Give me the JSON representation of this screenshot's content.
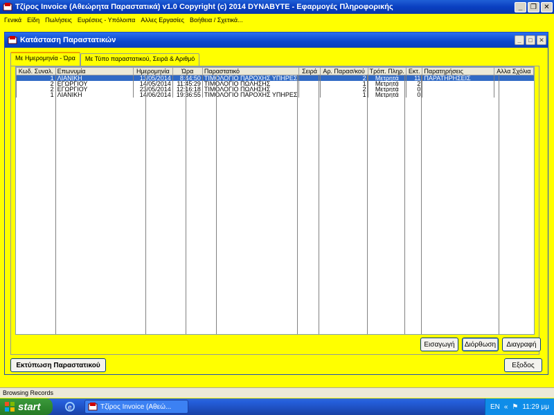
{
  "app": {
    "title": "Τζίρος Invoice (Αθεώρητα Παραστατικά)  v1.0  Copyright (c) 2014  DYNABYTE - Εφαρμογές Πληροφορικής"
  },
  "menu": [
    "Γενικά",
    "Είδη",
    "Πωλήσεις",
    "Ευρέσεις - Υπόλοιπα",
    "Αλλες Εργασίες",
    "Βοήθεια / Σχετικά..."
  ],
  "window": {
    "title": "Κατάσταση Παραστατικών"
  },
  "tabs": [
    "Με Ημερομηνία - Ώρα",
    "Με Τύπο παραστατικού, Σειρά & Αριθμό"
  ],
  "table": {
    "columns": [
      "Κωδ. Συναλ.",
      "Επωνυμία",
      "Ημερομηνία",
      "Ώρα",
      "Παραστατικό",
      "Σειρά",
      "Αρ. Παρασ/κού",
      "Τρόπ. Πληρ.",
      "Εκτ.",
      "Παρατηρήσεις",
      "Αλλα Σχόλια"
    ],
    "rows": [
      [
        "1",
        "ΛΙΑΝΙΚΗ",
        "13/05/2014",
        "8:44:50",
        "ΤΙΜΟΛΟΓΙΟ ΠΑΡΟΧΗΣ ΥΠΗΡΕΣ",
        "",
        "2",
        "Μετρητά",
        "11",
        "ΠΑΡΑΤΗΡΗΣΕΙΣ",
        ""
      ],
      [
        "2",
        "ΕΓΩΡΓΙΟΥ",
        "14/05/2014",
        "11:45:29",
        "ΤΙΜΟΛΟΓΙΟ ΠΩΛΗΣΗΣ",
        "",
        "1",
        "Μετρητά",
        "2",
        "",
        ""
      ],
      [
        "2",
        "ΕΓΩΡΓΙΟΥ",
        "23/05/2014",
        "12:16:18",
        "ΤΙΜΟΛΟΓΙΟ ΠΩΛΗΣΗΣ",
        "",
        "2",
        "Μετρητά",
        "0",
        "",
        ""
      ],
      [
        "1",
        "ΛΙΑΝΙΚΗ",
        "14/06/2014",
        "19:36:55",
        "ΤΙΜΟΛΟΓΙΟ ΠΑΡΟΧΗΣ ΥΠΗΡΕΣ",
        "",
        "1",
        "Μετρητά",
        "0",
        "",
        ""
      ]
    ]
  },
  "buttons": {
    "insert": "Εισαγωγή",
    "edit": "Διόρθωση",
    "delete": "Διαγραφή",
    "print": "Εκτύπωση Παραστατικού",
    "exit": "Εξοδος"
  },
  "status": "Browsing Records",
  "taskbar": {
    "start": "start",
    "task": "Τζίρος Invoice (Αθεώ...",
    "lang": "EN",
    "clock": "11:29 μμ"
  },
  "colors": {
    "background": "#ffff00",
    "selection": "#316ac5",
    "titlebar": "#0a3fc1"
  }
}
